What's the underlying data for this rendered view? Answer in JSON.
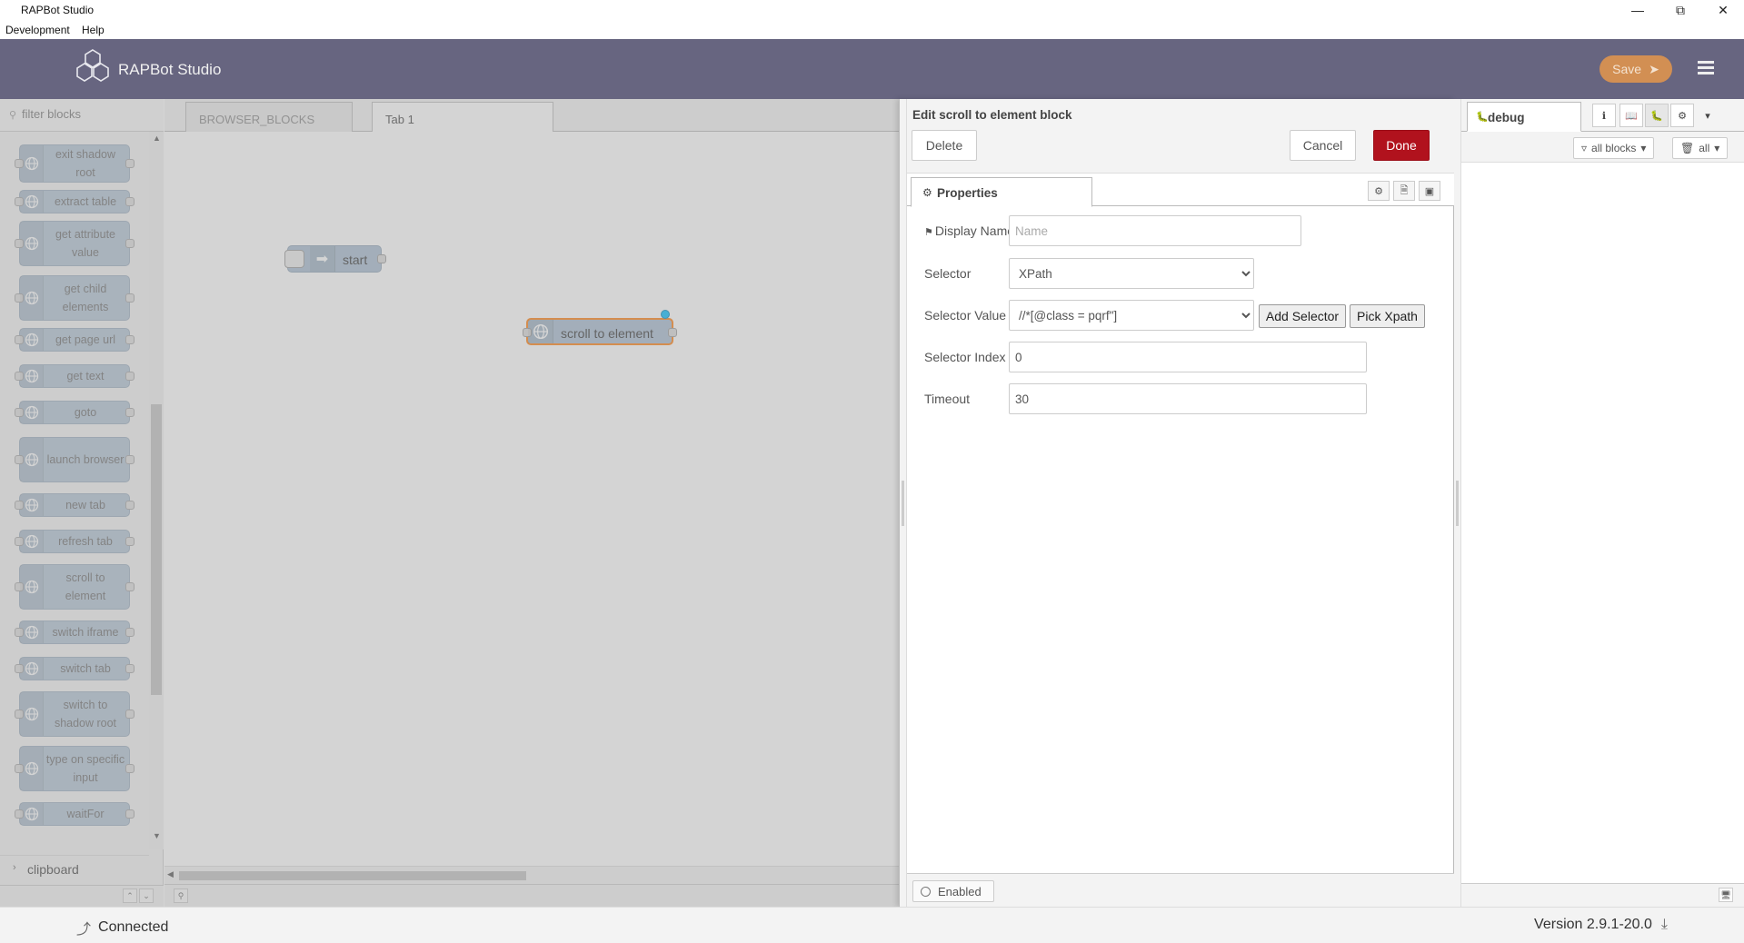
{
  "window": {
    "title": "RAPBot Studio",
    "minimize_icon": "minimize-icon",
    "maximize_icon": "restore-icon",
    "close_icon": "close-icon"
  },
  "menubar": {
    "items": [
      "Development",
      "Help"
    ]
  },
  "header": {
    "brand": "RAPBot Studio",
    "save_label": "Save",
    "accent": "#676580",
    "save_color": "#d28f53"
  },
  "palette": {
    "filter_placeholder": "filter blocks",
    "nodes": [
      "exit shadow root",
      "extract table",
      "get attribute value",
      "get child elements",
      "get page url",
      "get text",
      "goto",
      "launch browser",
      "new tab",
      "refresh tab",
      "scroll to element",
      "switch iframe",
      "switch tab",
      "switch to shadow root",
      "type on specific input",
      "waitFor"
    ],
    "category": "clipboard"
  },
  "workspace": {
    "tabs": [
      "BROWSER_BLOCKS",
      "Tab 1"
    ],
    "active_tab": "Tab 1",
    "nodes": {
      "start": "start",
      "scroll": "scroll to element"
    }
  },
  "tray": {
    "title": "Edit scroll to element block",
    "delete_label": "Delete",
    "cancel_label": "Cancel",
    "done_label": "Done",
    "properties_tab": "Properties",
    "fields": {
      "display_name_label": "Display Name",
      "display_name_placeholder": "Name",
      "display_name_value": "",
      "selector_label": "Selector",
      "selector_value": "XPath",
      "selector_value_label": "Selector Value",
      "selector_value_value": "//*[@class = pqrf\"]",
      "add_selector_label": "Add Selector",
      "pick_xpath_label": "Pick Xpath",
      "selector_index_label": "Selector Index",
      "selector_index_value": "0",
      "timeout_label": "Timeout",
      "timeout_value": "30"
    },
    "enabled_label": "Enabled",
    "done_color": "#b1121d"
  },
  "sidebar": {
    "tab": "debug",
    "filter_label": "all blocks",
    "clear_label": "all"
  },
  "status": {
    "connection": "Connected",
    "version": "Version 2.9.1-20.0"
  }
}
